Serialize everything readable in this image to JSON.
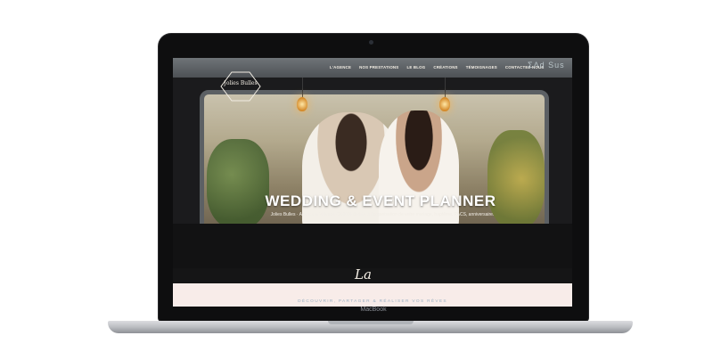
{
  "device": {
    "brand": "MacBook"
  },
  "site": {
    "logo_text": "Jolies Bulles",
    "nav": [
      {
        "label": "L'AGENCE"
      },
      {
        "label": "NOS PRESTATIONS"
      },
      {
        "label": "LE BLOG"
      },
      {
        "label": "CRÉATIONS"
      },
      {
        "label": "TÉMOIGNAGES"
      },
      {
        "label": "CONTACTEZ-NOUS"
      }
    ],
    "nav_extra": "ΣΛd Sus",
    "hero": {
      "title": "WEDDING & EVENT PLANNER",
      "subtitle": "Jolies Bulles · Agence à Valence (26000) dédiée à l'organisation de votre mariage, baptême, PACS, anniversaire."
    },
    "section_script": "La",
    "tagline": "DÉCOUVRIR, PARTAGER & RÉALISER VOS RÊVES"
  }
}
